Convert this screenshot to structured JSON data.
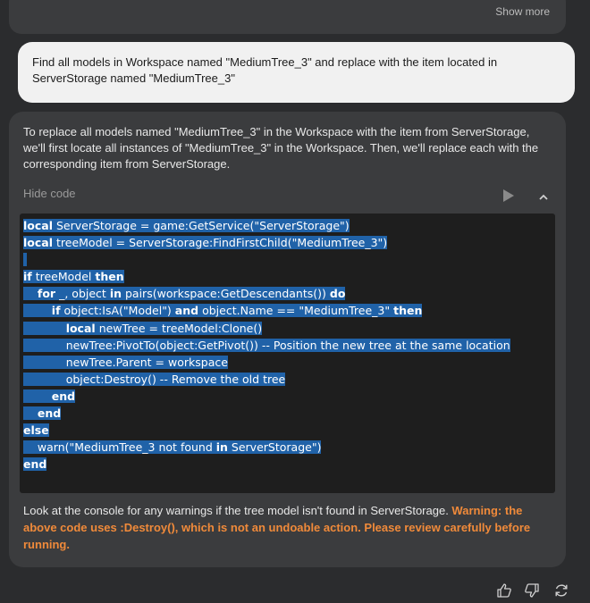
{
  "previous": {
    "show_more": "Show more"
  },
  "user_message": "Find all models in Workspace named \"MediumTree_3\" and replace with the item located in ServerStorage named \"MediumTree_3\"",
  "assistant": {
    "intro": "To replace all models named \"MediumTree_3\" in the Workspace with the item from ServerStorage, we'll first locate all instances of \"MediumTree_3\" in the Workspace. Then, we'll replace each with the corresponding item from ServerStorage.",
    "hide_code": "Hide code",
    "code_lines": [
      "local ServerStorage = game:GetService(\"ServerStorage\")",
      "local treeModel = ServerStorage:FindFirstChild(\"MediumTree_3\")",
      "",
      "if treeModel then",
      "    for _, object in pairs(workspace:GetDescendants()) do",
      "        if object:IsA(\"Model\") and object.Name == \"MediumTree_3\" then",
      "            local newTree = treeModel:Clone()",
      "            newTree:PivotTo(object:GetPivot()) -- Position the new tree at the same location",
      "            newTree.Parent = workspace",
      "            object:Destroy() -- Remove the old tree",
      "        end",
      "    end",
      "else",
      "    warn(\"MediumTree_3 not found in ServerStorage\")",
      "end"
    ],
    "footer_text": "Look at the console for any warnings if the tree model isn't found in ServerStorage. ",
    "footer_warning": "Warning: the above code uses :Destroy(), which is not an undoable action. Please review carefully before running."
  },
  "icons": {
    "play": "play-icon",
    "collapse": "chevron-up-icon",
    "thumbs_up": "thumbs-up-icon",
    "thumbs_down": "thumbs-down-icon",
    "regenerate": "regenerate-icon"
  },
  "colors": {
    "background": "#2b2c2e",
    "card": "#3b3c3e",
    "user_bubble": "#f1f1f1",
    "code_bg": "#1e1e1e",
    "selection": "#2062a8",
    "warning": "#f08a3a"
  }
}
